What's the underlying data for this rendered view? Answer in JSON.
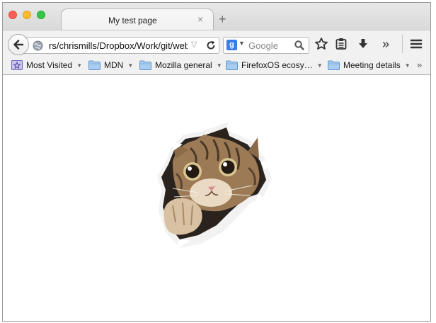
{
  "window": {
    "controls": [
      "close",
      "minimize",
      "maximize"
    ]
  },
  "tab": {
    "title": "My test page",
    "close_glyph": "×",
    "new_tab_glyph": "+"
  },
  "toolbar": {
    "back_icon": "back-arrow-icon",
    "url": "rs/chrismills/Dropbox/Work/git/web-",
    "url_dropdown_glyph": "▽",
    "search_engine_logo": "g",
    "search_placeholder": "Google",
    "icons": [
      "reload-icon",
      "search-icon",
      "star-icon",
      "reading-list-icon",
      "download-icon",
      "overflow-chevrons-icon",
      "hamburger-menu-icon"
    ],
    "overflow_glyph": "»"
  },
  "bookmarks": {
    "items": [
      {
        "label": "Most Visited",
        "icon": "most-visited-icon"
      },
      {
        "label": "MDN",
        "icon": "folder-icon"
      },
      {
        "label": "Mozilla general",
        "icon": "folder-icon"
      },
      {
        "label": "FirefoxOS ecosy…",
        "icon": "folder-icon"
      },
      {
        "label": "Meeting details",
        "icon": "folder-icon"
      }
    ],
    "overflow_glyph": "»"
  },
  "content": {
    "image_subject": "cat-peeking-through-torn-paper"
  }
}
